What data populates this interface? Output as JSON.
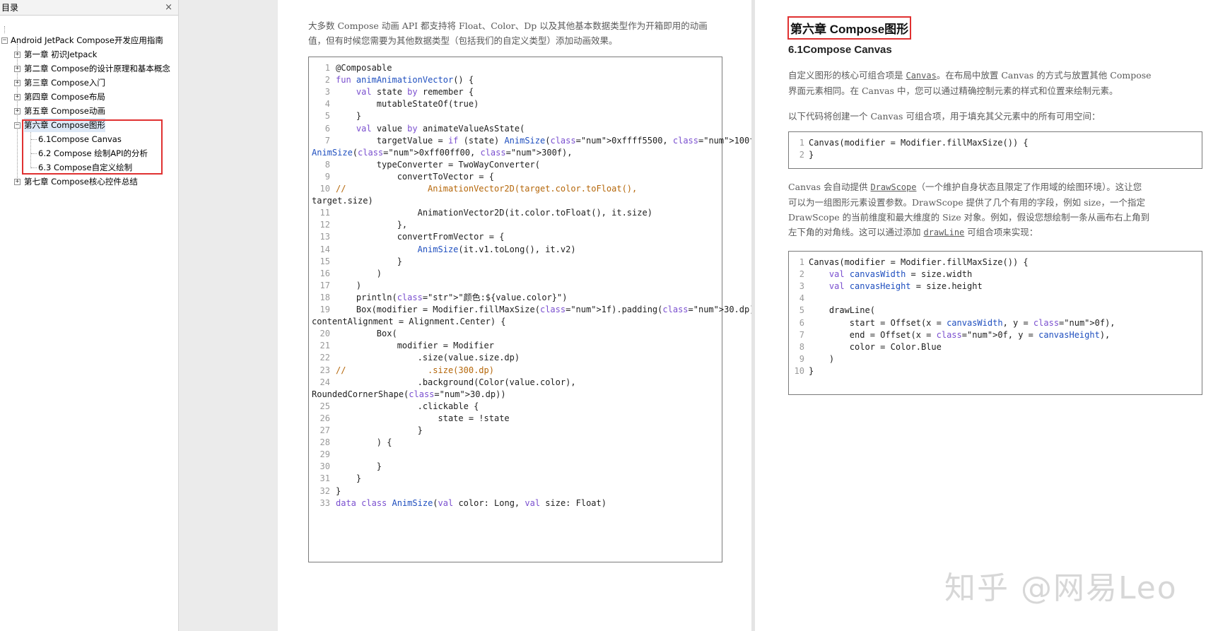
{
  "sidebar": {
    "title": "目录",
    "close": "×",
    "root": "Android JetPack Compose开发应用指南",
    "chapters": [
      "第一章 初识Jetpack",
      "第二章 Compose的设计原理和基本概念",
      "第三章 Compose入门",
      "第四章 Compose布局",
      "第五章 Compose动画",
      "第六章 Compose图形",
      "第七章 Compose核心控件总结"
    ],
    "sections": [
      "6.1Compose Canvas",
      "6.2 Compose 绘制API的分析",
      "6.3 Compose自定义绘制"
    ],
    "expand": "+",
    "collapse": "−"
  },
  "left_page": {
    "intro": "大多数 Compose 动画 API 都支持将 Float、Color、Dp 以及其他基本数据类型作为开箱即用的动画值，但有时候您需要为其他数据类型（包括我们的自定义类型）添加动画效果。",
    "code_numbers": [
      "1",
      "2",
      "3",
      "4",
      "5",
      "6",
      "7",
      "8",
      "9",
      "10",
      "11",
      "12",
      "13",
      "14",
      "15",
      "16",
      "17",
      "18",
      "19",
      "20",
      "21",
      "22",
      "23",
      "24",
      "25",
      "26",
      "27",
      "28",
      "29",
      "30",
      "31",
      "32",
      "33"
    ],
    "code": [
      "@Composable",
      "fun animAnimationVector() {",
      "    val state by remember {",
      "        mutableStateOf(true)",
      "    }",
      "    val value by animateValueAsState(",
      "        targetValue = if (state) AnimSize(0xffff5500, 100f) else",
      "AnimSize(0xff00ff00, 300f),",
      "        typeConverter = TwoWayConverter(",
      "            convertToVector = {",
      "//                AnimationVector2D(target.color.toFloat(),",
      "target.size)",
      "                AnimationVector2D(it.color.toFloat(), it.size)",
      "            },",
      "            convertFromVector = {",
      "                AnimSize(it.v1.toLong(), it.v2)",
      "            }",
      "        )",
      "    )",
      "    println(\"颜色:${value.color}\")",
      "    Box(modifier = Modifier.fillMaxSize(1f).padding(30.dp),",
      "contentAlignment = Alignment.Center) {",
      "        Box(",
      "            modifier = Modifier",
      "                .size(value.size.dp)",
      "//                .size(300.dp)",
      "                .background(Color(value.color),",
      "RoundedCornerShape(30.dp))",
      "                .clickable {",
      "                    state = !state",
      "                }",
      "        ) {",
      "",
      "        }",
      "    }",
      "}",
      "data class AnimSize(val color: Long, val size: Float)"
    ]
  },
  "right_page": {
    "chapter_title": "第六章 Compose图形",
    "section_title": "6.1Compose Canvas",
    "p1_a": "自定义图形的核心可组合项是 ",
    "p1_link": "Canvas",
    "p1_b": "。在布局中放置 Canvas 的方式与放置其他 Compose",
    "p1_c": "界面元素相同。在 Canvas 中，您可以通过精确控制元素的样式和位置来绘制元素。",
    "p2": "以下代码将创建一个 Canvas 可组合项，用于填充其父元素中的所有可用空间：",
    "code1": [
      "Canvas(modifier = Modifier.fillMaxSize()) {",
      "}"
    ],
    "code1_numbers": [
      "1",
      "2"
    ],
    "p3_a": "Canvas 会自动提供 ",
    "p3_link": "DrawScope",
    "p3_b": "（一个维护自身状态且限定了作用域的绘图环境）。这让您",
    "p3_c": "可以为一组图形元素设置参数。DrawScope 提供了几个有用的字段，例如 size，一个指定",
    "p3_d": "DrawScope 的当前维度和最大维度的 Size 对象。例如，假设您想绘制一条从画布右上角到",
    "p3_e": "左下角的对角线。这可以通过添加 ",
    "p3_link2": "drawLine",
    "p3_f": " 可组合项来实现：",
    "code2_numbers": [
      "1",
      "2",
      "3",
      "4",
      "5",
      "6",
      "7",
      "8",
      "9",
      "10"
    ],
    "code2": [
      "Canvas(modifier = Modifier.fillMaxSize()) {",
      "    val canvasWidth = size.width",
      "    val canvasHeight = size.height",
      "",
      "    drawLine(",
      "        start = Offset(x = canvasWidth, y = 0f),",
      "        end = Offset(x = 0f, y = canvasHeight),",
      "        color = Color.Blue",
      "    )",
      "}"
    ]
  },
  "watermark": "知乎 @网易Leo",
  "colors": {
    "highlight_border": "#e03131",
    "selected_bg": "#dde8f6"
  }
}
